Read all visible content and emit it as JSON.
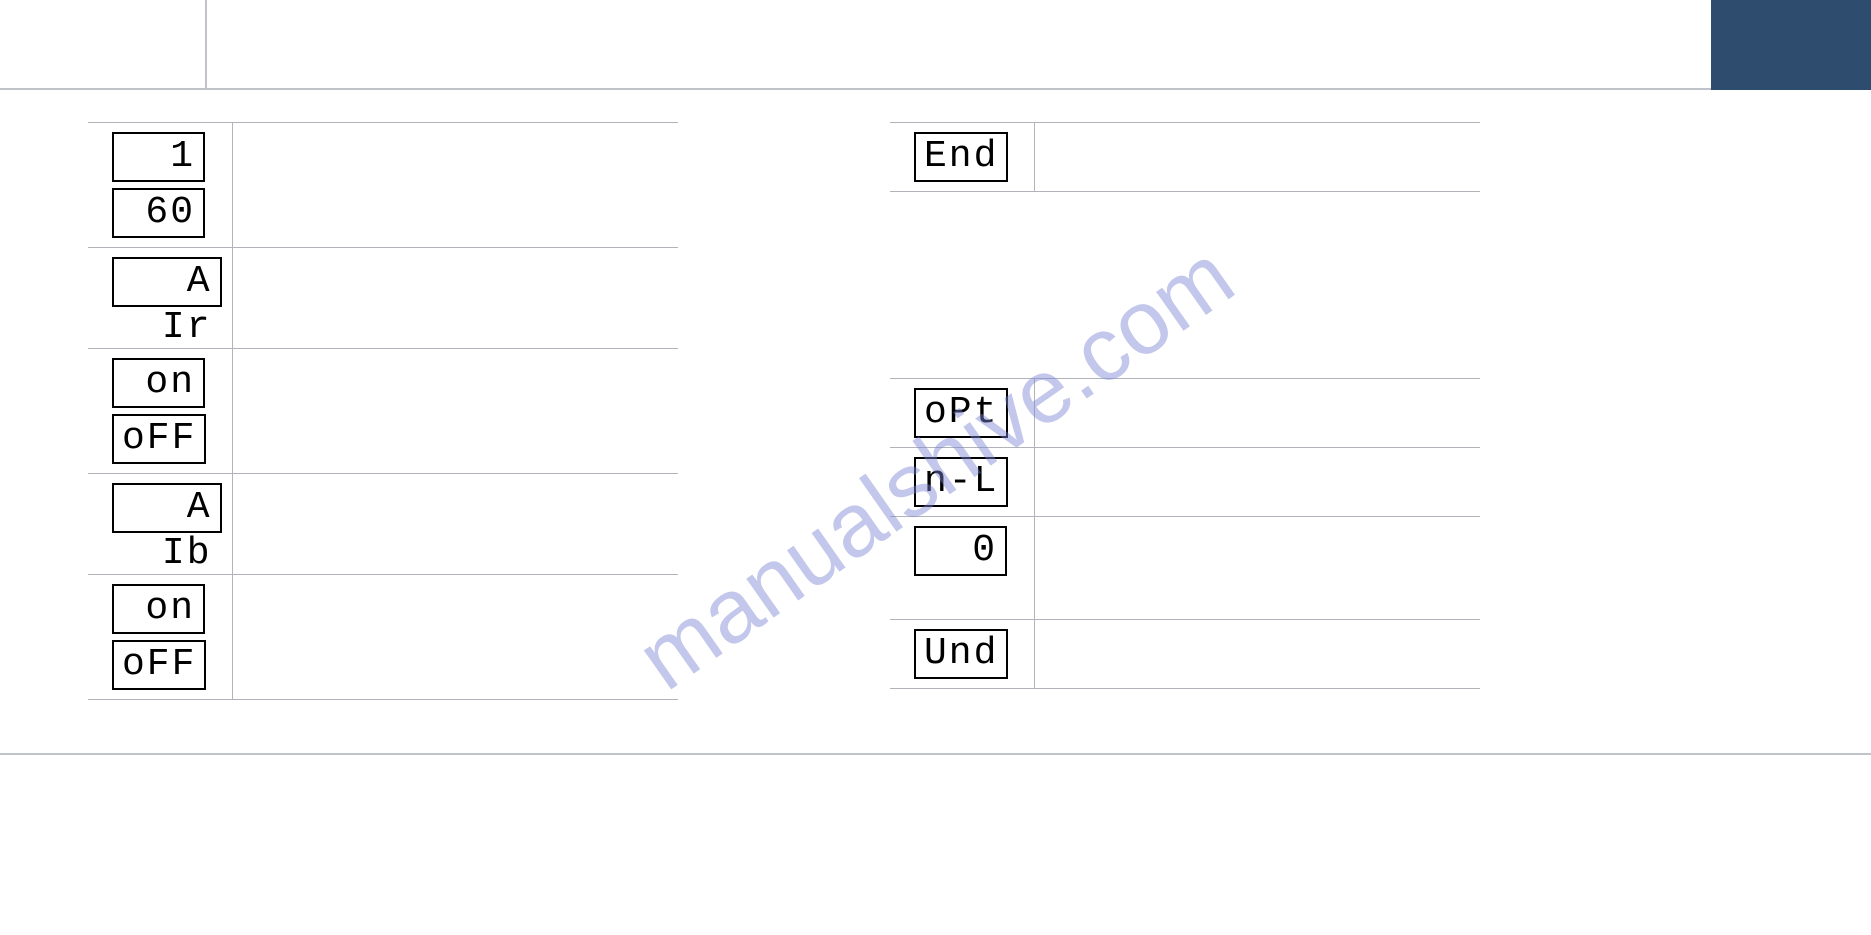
{
  "watermark": "manualshive.com",
  "left_rows": [
    {
      "cells": [
        "1",
        "60"
      ]
    },
    {
      "cells": [
        "AIr"
      ]
    },
    {
      "cells": [
        "on",
        "oFF"
      ]
    },
    {
      "cells": [
        "AIb"
      ]
    },
    {
      "cells": [
        "on",
        "oFF"
      ]
    }
  ],
  "right_rows_1": [
    {
      "cells": [
        "End"
      ]
    }
  ],
  "right_rows_2": [
    {
      "cells": [
        "oPt"
      ]
    },
    {
      "cells": [
        "n-L"
      ]
    },
    {
      "cells": [
        "0"
      ]
    },
    {
      "cells": [
        "Und"
      ]
    }
  ],
  "lcd": {
    "one": "1",
    "sixty": "60",
    "air": "A Ir",
    "on": " on",
    "off": "oFF",
    "aib": "A Ib",
    "end": "End",
    "opt": "oPt",
    "nl": "n-L",
    "zero": "0",
    "und": "Und"
  }
}
